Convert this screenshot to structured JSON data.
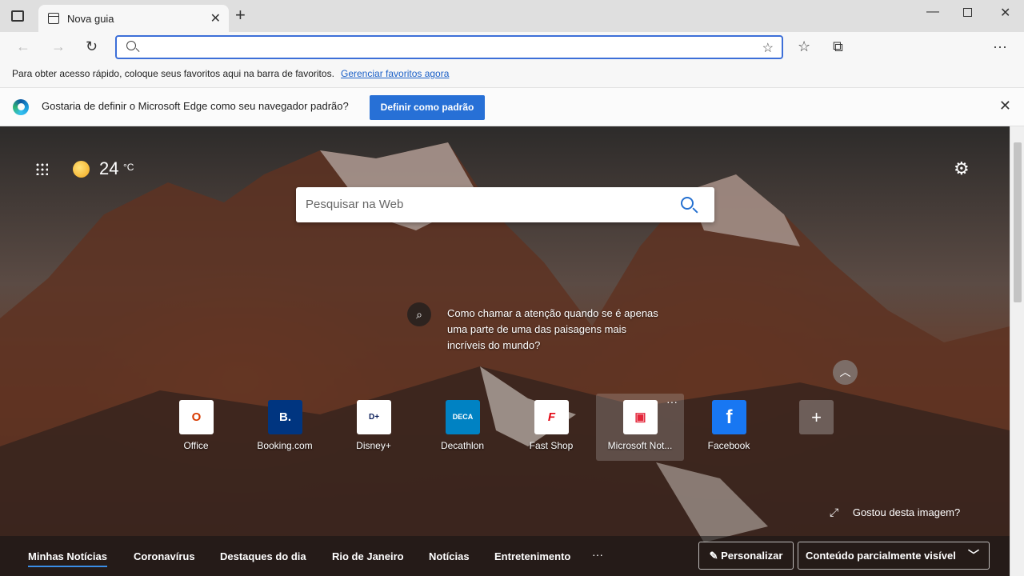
{
  "tab": {
    "title": "Nova guia",
    "close": "✕"
  },
  "toolbar": {
    "omnibox_value": ""
  },
  "favorites_bar": {
    "message": "Para obter acesso rápido, coloque seus favoritos aqui na barra de favoritos.",
    "link": "Gerenciar favoritos agora"
  },
  "infobar": {
    "message": "Gostaria de definir o Microsoft Edge como seu navegador padrão?",
    "button": "Definir como padrão"
  },
  "weather": {
    "temp": "24",
    "unit": "°C",
    "icon": "sun-icon"
  },
  "search": {
    "placeholder": "Pesquisar na Web"
  },
  "image_caption": "Como chamar a atenção quando se é apenas uma parte de uma das paisagens mais incríveis do mundo?",
  "quick_links": [
    {
      "label": "Office",
      "icon": "office-icon",
      "color": "#d83b01"
    },
    {
      "label": "Booking.com",
      "icon": "booking-icon",
      "color": "#003580"
    },
    {
      "label": "Disney+",
      "icon": "disney-icon",
      "color": "#0b1f5b"
    },
    {
      "label": "Decathlon",
      "icon": "decathlon-icon",
      "color": "#0082c3"
    },
    {
      "label": "Fast Shop",
      "icon": "fastshop-icon",
      "color": "#e30613"
    },
    {
      "label": "Microsoft Not...",
      "icon": "msn-icon",
      "color": "#e3263a"
    },
    {
      "label": "Facebook",
      "icon": "facebook-icon",
      "color": "#1877f2"
    }
  ],
  "like_image": "Gostou desta imagem?",
  "news_tabs": [
    "Minhas Notícias",
    "Coronavírus",
    "Destaques do dia",
    "Rio de Janeiro",
    "Notícias",
    "Entretenimento"
  ],
  "news_more": "···",
  "personalize": "Personalizar",
  "content_select": "Conteúdo parcialmente visível",
  "colors": {
    "accent": "#2770d6",
    "link": "#1a5fc7"
  }
}
